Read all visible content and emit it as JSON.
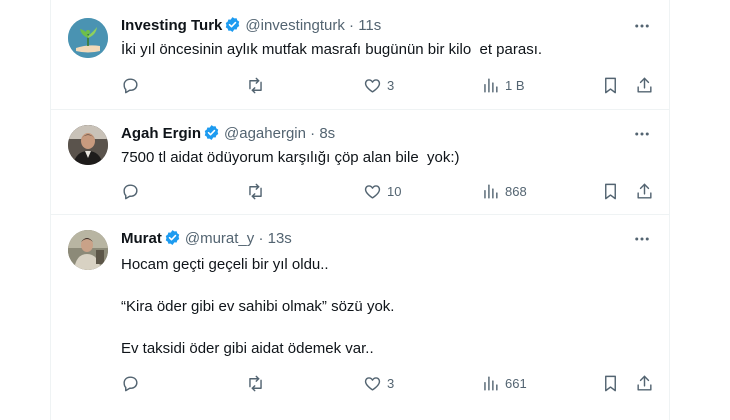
{
  "tweets": [
    {
      "name": "Investing Turk",
      "handle": "@investingturk",
      "dot": "·",
      "time": "11s",
      "lines": [
        "İki yıl öncesinin aylık mutfak masrafı bugünün bir kilo  et parası."
      ],
      "replies": "",
      "retweets": "",
      "likes": "3",
      "views": "1 B",
      "avatar": "plant-in-hand-logo"
    },
    {
      "name": "Agah Ergin",
      "handle": "@agahergin",
      "dot": "·",
      "time": "8s",
      "lines": [
        "7500 tl aidat ödüyorum karşılığı çöp alan bile  yok:)"
      ],
      "replies": "",
      "retweets": "",
      "likes": "10",
      "views": "868",
      "avatar": "profile-photo"
    },
    {
      "name": "Murat",
      "handle": "@murat_y",
      "dot": "·",
      "time": "13s",
      "lines": [
        "Hocam geçti geçeli bir yıl oldu..",
        "“Kira öder gibi ev sahibi olmak” sözü yok.",
        "Ev taksidi öder gibi aidat ödemek var.."
      ],
      "replies": "",
      "retweets": "",
      "likes": "3",
      "views": "661",
      "avatar": "profile-photo"
    }
  ],
  "colors": {
    "verified": "#1d9bf0",
    "text": "#0f1419",
    "muted": "#536471",
    "border": "#eff3f4"
  }
}
